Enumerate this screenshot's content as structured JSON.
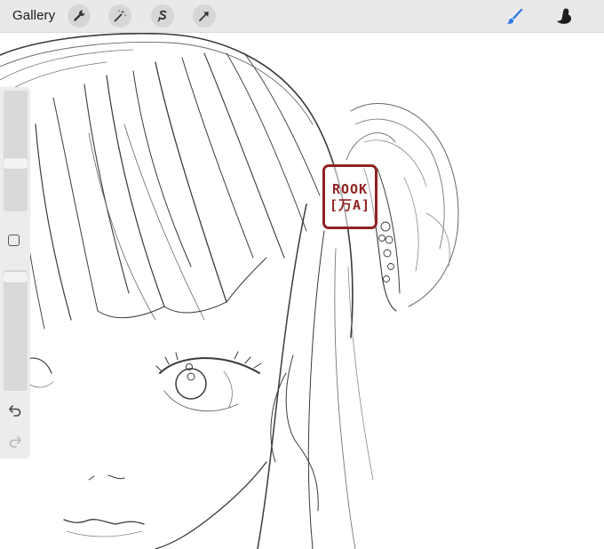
{
  "topbar": {
    "gallery_label": "Gallery",
    "left_tools": [
      "wrench-icon",
      "magic-wand-icon",
      "selection-s-icon",
      "arrow-transform-icon"
    ],
    "right_tools": [
      "brush-icon",
      "smudge-icon"
    ],
    "accent_color": "#2f7ae5"
  },
  "sidebar": {
    "top_slider_value": 0.4,
    "bottom_slider_value": 0.95,
    "buttons": [
      "modify-square-button",
      "undo-button",
      "redo-button"
    ]
  },
  "canvas": {
    "seal": {
      "lines": [
        "ROOK",
        "[万A]"
      ],
      "color": "#8f2322"
    }
  }
}
